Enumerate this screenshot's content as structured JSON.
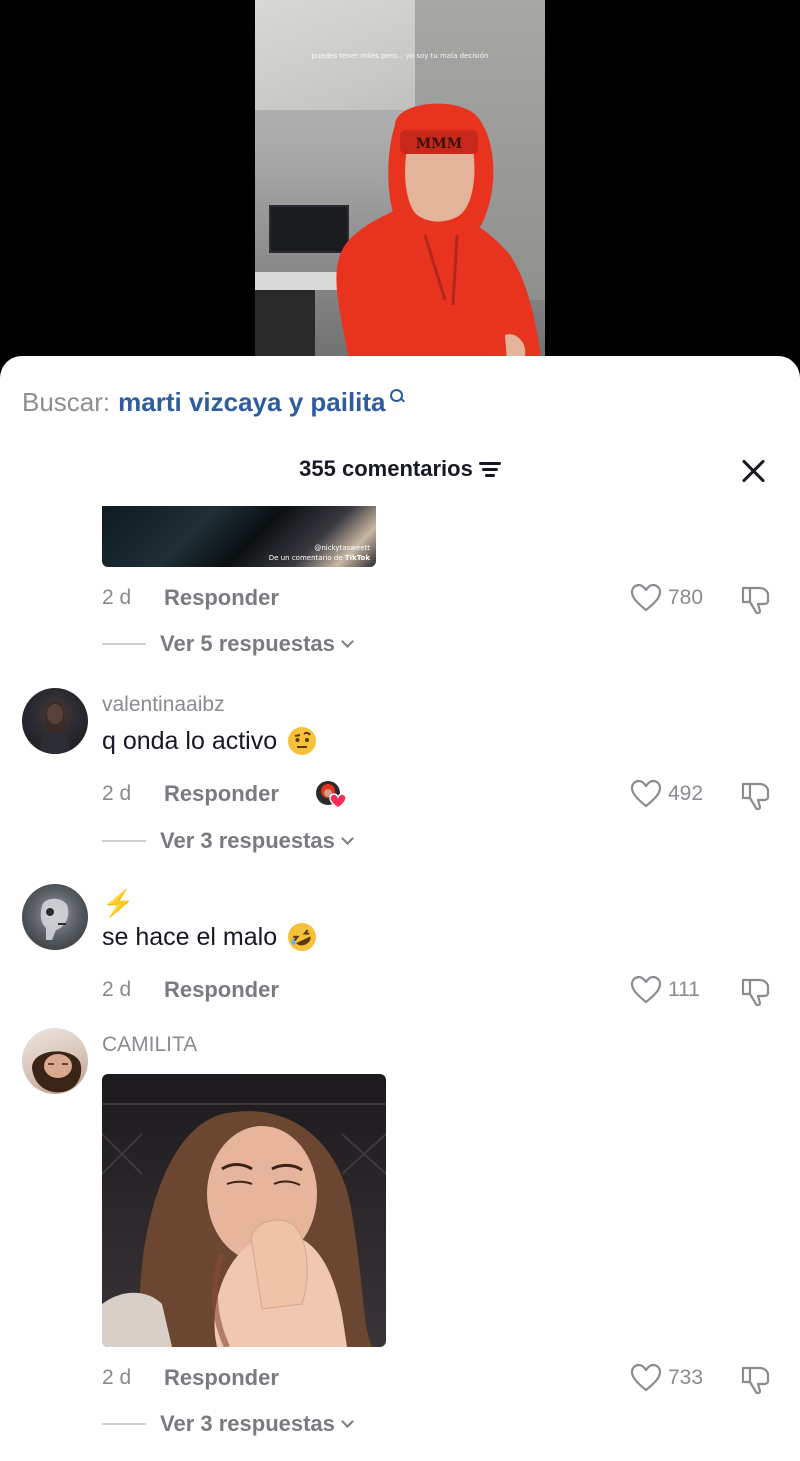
{
  "video": {
    "caption": "puedes tener miles pero... yo soy tu mala decisión"
  },
  "search": {
    "prefix": "Buscar:",
    "term": "marti vizcaya y pailita",
    "icon": "search-icon"
  },
  "header": {
    "count_label": "355 comentarios",
    "sort_icon": "sort-icon",
    "close_icon": "close-icon"
  },
  "comments": [
    {
      "media": {
        "watermark_user": "@nickytasweett",
        "watermark_source": "De un comentario de",
        "watermark_brand": "TikTok"
      },
      "time": "2 d",
      "reply_label": "Responder",
      "likes": "780",
      "replies_label": "Ver 5 respuestas"
    },
    {
      "username": "valentinaaibz",
      "text": "q onda lo activo",
      "emoji": "face-with-raised-eyebrow",
      "time": "2 d",
      "reply_label": "Responder",
      "creator_liked": true,
      "likes": "492",
      "replies_label": "Ver 3 respuestas"
    },
    {
      "username": "⚡",
      "text": "se hace el malo",
      "emoji": "rolling-on-floor-laughing",
      "time": "2 d",
      "reply_label": "Responder",
      "likes": "111"
    },
    {
      "username": "CAMILITA",
      "time": "2 d",
      "reply_label": "Responder",
      "likes": "733",
      "replies_label": "Ver 3 respuestas"
    }
  ],
  "colors": {
    "accent_link": "#2f5d9c",
    "text_primary": "#161823",
    "text_secondary": "#8a8b91",
    "hoodie": "#e8341f"
  }
}
